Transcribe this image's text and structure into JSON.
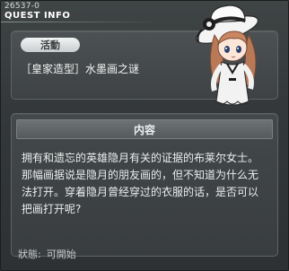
{
  "window": {
    "quest_id": "26537-0",
    "title": "QUEST INFO"
  },
  "header": {
    "category_badge": "活動",
    "quest_title": "［皇家造型］水墨画之谜"
  },
  "content": {
    "section_title": "内容",
    "lines": [
      "拥有和遗忘的英雄隐月有关的证据的布莱尔女士。",
      "那幅画据说是隐月的朋友画的，但不知道为什么无",
      "法打开。穿着隐月曾经穿过的衣服的话，是否可以",
      "把画打开呢?"
    ]
  },
  "status": {
    "label": "狀態:",
    "value": "可開始"
  },
  "icons": {
    "npc_portrait": "npc-portrait-icon"
  },
  "colors": {
    "window_bg": "#34383a",
    "panel_border": "#5e6365",
    "badge_bg": "#e4e7e8",
    "text": "#eceeee"
  }
}
